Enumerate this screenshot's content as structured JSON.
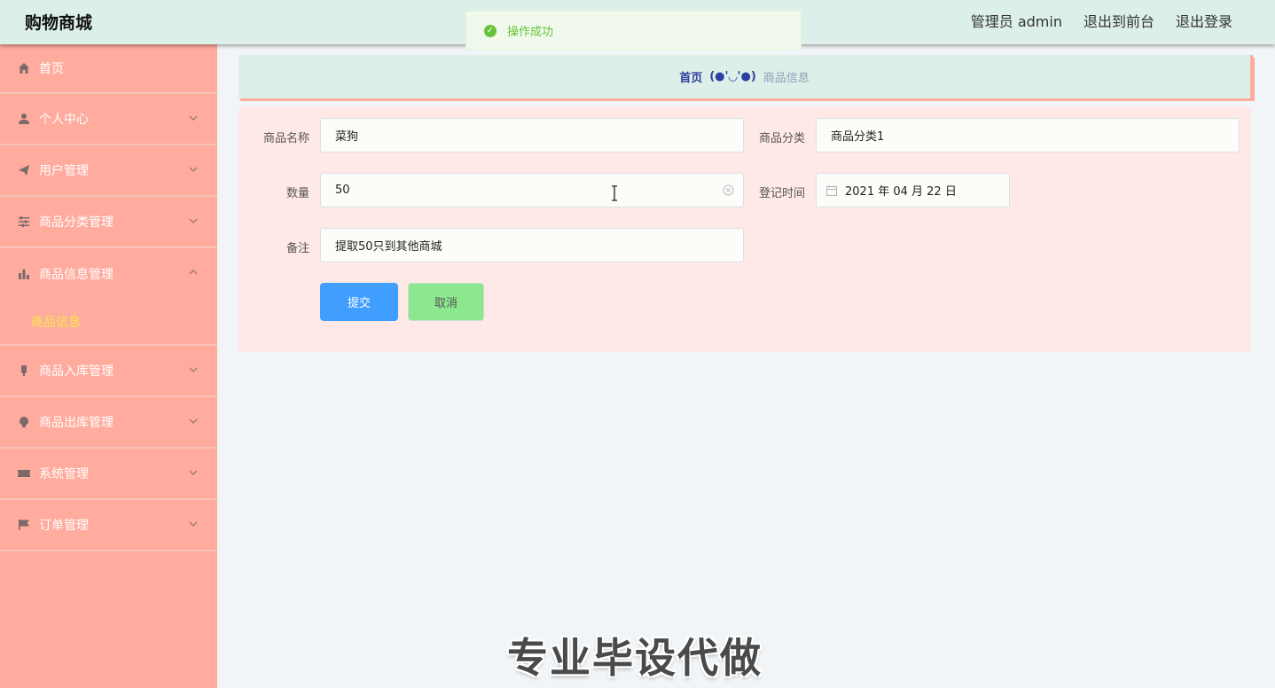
{
  "header": {
    "brand": "购物商城",
    "admin": "管理员 admin",
    "to_front": "退出到前台",
    "logout": "退出登录"
  },
  "toast": {
    "text": "操作成功",
    "color": "#67c23a"
  },
  "sidebar": {
    "items": [
      {
        "label": "首页",
        "icon": "home-icon"
      },
      {
        "label": "个人中心",
        "icon": "user-icon",
        "arrow": "chevron-down-icon"
      },
      {
        "label": "用户管理",
        "icon": "paper-plane-icon",
        "arrow": "chevron-down-icon"
      },
      {
        "label": "商品分类管理",
        "icon": "sliders-icon",
        "arrow": "chevron-down-icon"
      },
      {
        "label": "商品信息管理",
        "icon": "bar-chart-icon",
        "arrow": "chevron-up-icon"
      },
      {
        "label": "商品入库管理",
        "icon": "microphone-icon",
        "arrow": "chevron-down-icon"
      },
      {
        "label": "商品出库管理",
        "icon": "bulb-icon",
        "arrow": "chevron-down-icon"
      },
      {
        "label": "系统管理",
        "icon": "ticket-icon",
        "arrow": "chevron-down-icon"
      },
      {
        "label": "订单管理",
        "icon": "flag-icon",
        "arrow": "chevron-down-icon"
      }
    ],
    "submenu": {
      "label": "商品信息"
    }
  },
  "breadcrumb": {
    "home": "首页",
    "separator": "(●'◡'●)",
    "current": "商品信息"
  },
  "form": {
    "name_label": "商品名称",
    "name_value": "菜狗",
    "category_label": "商品分类",
    "category_value": "商品分类1",
    "quantity_label": "数量",
    "quantity_value": "50",
    "date_label": "登记时间",
    "date_value": "2021 年 04 月 22 日",
    "remark_label": "备注",
    "remark_value": "提取50只到其他商城",
    "submit_label": "提交",
    "cancel_label": "取消"
  },
  "watermark": "专业毕设代做",
  "colors": {
    "sidebar": "#ffab9e",
    "header": "#dcefe8",
    "panel": "#ffe9e6",
    "submit": "#409eff",
    "cancel": "#8ce88e",
    "active_sub": "#f5e94a"
  }
}
